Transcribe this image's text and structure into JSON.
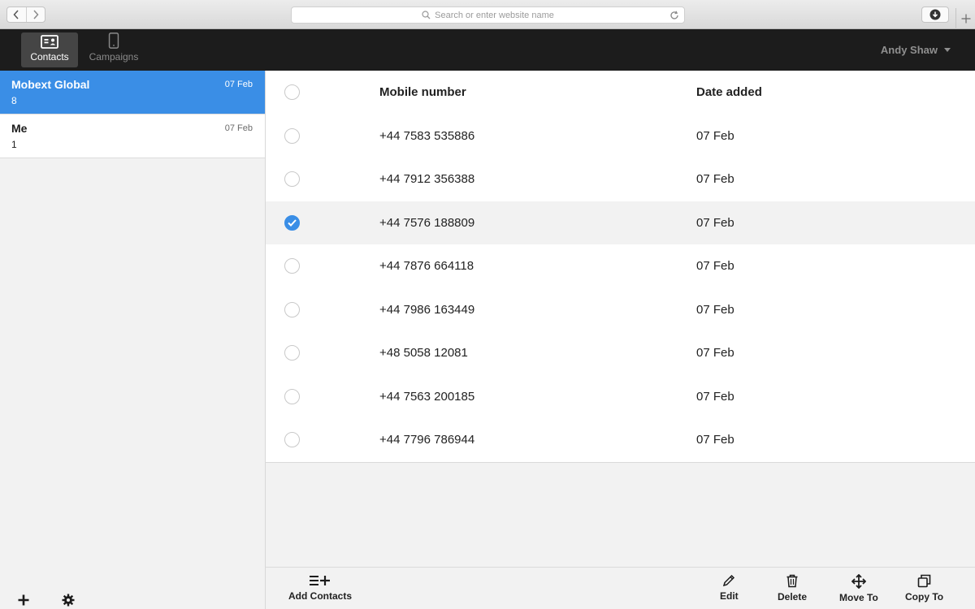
{
  "browser": {
    "address_placeholder": "Search or enter website name"
  },
  "header": {
    "tabs": [
      {
        "label": "Contacts",
        "icon": "contacts-card-icon",
        "active": true
      },
      {
        "label": "Campaigns",
        "icon": "phone-icon",
        "active": false
      }
    ],
    "user_name": "Andy Shaw"
  },
  "sidebar": {
    "groups": [
      {
        "name": "Mobext Global",
        "count": "8",
        "date": "07 Feb",
        "selected": true
      },
      {
        "name": "Me",
        "count": "1",
        "date": "07 Feb",
        "selected": false
      }
    ],
    "footer_icons": [
      "plus-icon",
      "gear-icon"
    ]
  },
  "table": {
    "headers": {
      "number": "Mobile number",
      "date": "Date added"
    },
    "rows": [
      {
        "number": "+44 7583 535886",
        "date": "07 Feb",
        "checked": false
      },
      {
        "number": "+44 7912 356388",
        "date": "07 Feb",
        "checked": false
      },
      {
        "number": "+44 7576 188809",
        "date": "07 Feb",
        "checked": true
      },
      {
        "number": "+44 7876 664118",
        "date": "07 Feb",
        "checked": false
      },
      {
        "number": "+44 7986 163449",
        "date": "07 Feb",
        "checked": false
      },
      {
        "number": "+48 5058 12081",
        "date": "07 Feb",
        "checked": false
      },
      {
        "number": "+44 7563 200185",
        "date": "07 Feb",
        "checked": false
      },
      {
        "number": "+44 7796 786944",
        "date": "07 Feb",
        "checked": false
      }
    ]
  },
  "toolbar": {
    "add_contacts": "Add Contacts",
    "edit": "Edit",
    "delete": "Delete",
    "move_to": "Move To",
    "copy_to": "Copy To"
  },
  "colors": {
    "accent": "#3a8ee6",
    "header_bg": "#1c1c1c"
  }
}
